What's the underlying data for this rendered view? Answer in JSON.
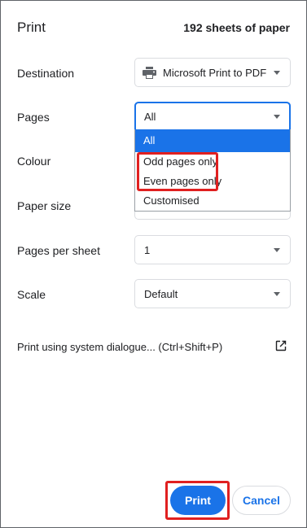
{
  "header": {
    "title": "Print",
    "sheet_count": "192 sheets of paper"
  },
  "settings": {
    "destination": {
      "label": "Destination",
      "value": "Microsoft Print to PDF",
      "icon": "printer-icon"
    },
    "pages": {
      "label": "Pages",
      "value": "All"
    },
    "colour": {
      "label": "Colour"
    },
    "paper_size": {
      "label": "Paper size"
    },
    "pages_per_sheet": {
      "label": "Pages per sheet",
      "value": "1"
    },
    "scale": {
      "label": "Scale",
      "value": "Default"
    }
  },
  "pages_dropdown": {
    "options": [
      "All",
      "Odd pages only",
      "Even pages only",
      "Customised"
    ],
    "selected": "All"
  },
  "system_dialogue": {
    "label": "Print using system dialogue... (Ctrl+Shift+P)",
    "icon": "open-in-new-icon"
  },
  "actions": {
    "print_label": "Print",
    "cancel_label": "Cancel"
  },
  "colors": {
    "accent": "#1a73e8",
    "highlight_box": "#e02020"
  }
}
